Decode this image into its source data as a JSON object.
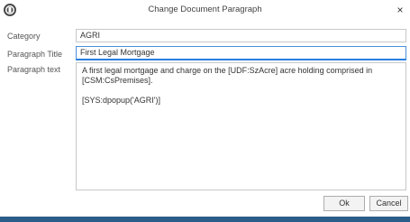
{
  "window": {
    "title": "Change Document Paragraph",
    "close_glyph": "×"
  },
  "form": {
    "category_label": "Category",
    "category_value": "AGRI",
    "title_label": "Paragraph Title",
    "title_value": "First Legal Mortgage",
    "text_label": "Paragraph text",
    "text_line1": "A first legal mortgage and charge on the [UDF:SzAcre] acre holding comprised in",
    "text_line2": "[CSM:CsPremises].",
    "text_line3": "[SYS:dpopup('AGRI')]"
  },
  "buttons": {
    "ok_label": "Ok",
    "cancel_label": "Cancel"
  },
  "icons": {
    "logo": "app-logo-icon",
    "close": "close-icon"
  },
  "colors": {
    "focus_border": "#2b7de0",
    "taskbar": "#2b5d8a"
  }
}
